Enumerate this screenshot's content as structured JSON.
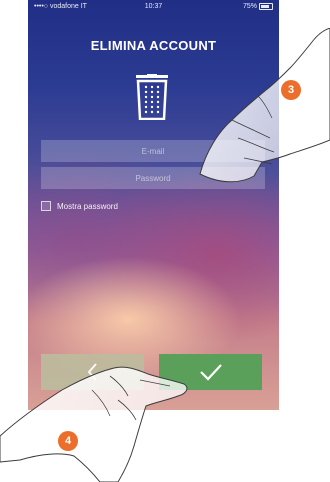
{
  "statusbar": {
    "carrier": "••••○ vodafone IT",
    "time": "10:37",
    "battery": "75%"
  },
  "screen": {
    "title": "ELIMINA ACCOUNT",
    "trash_icon": "trash-icon",
    "email_placeholder": "E-mail",
    "password_placeholder": "Password",
    "show_password_label": "Mostra password",
    "back_icon": "chevron-left-icon",
    "confirm_icon": "checkmark-icon"
  },
  "annotations": {
    "step_3": "3",
    "step_4": "4"
  },
  "colors": {
    "confirm_button": "#5aa05b",
    "back_button": "#bdbb9e",
    "badge": "#ec6e2b"
  }
}
